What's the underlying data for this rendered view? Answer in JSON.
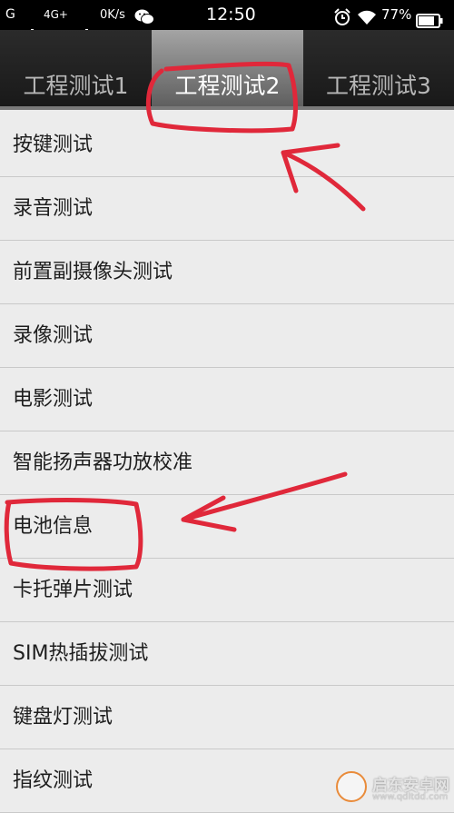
{
  "status_bar": {
    "carrier": "G",
    "network": "4G+",
    "speed": "0K/s",
    "time": "12:50",
    "battery": "77%",
    "icons": [
      "signal-icon",
      "signal-icon",
      "wechat-icon",
      "alarm-icon",
      "wifi-icon",
      "battery-icon"
    ]
  },
  "tabs": [
    {
      "label": "工程测试1",
      "selected": false
    },
    {
      "label": "工程测试2",
      "selected": true
    },
    {
      "label": "工程测试3",
      "selected": false
    }
  ],
  "list_items": [
    "按键测试",
    "录音测试",
    "前置副摄像头测试",
    "录像测试",
    "电影测试",
    "智能扬声器功放校准",
    "电池信息",
    "卡托弹片测试",
    "SIM热插拔测试",
    "键盘灯测试",
    "指纹测试"
  ],
  "annotation_color": "#e0283a",
  "watermark": {
    "text": "启东安卓网",
    "url": "www.qdltdd.com"
  }
}
